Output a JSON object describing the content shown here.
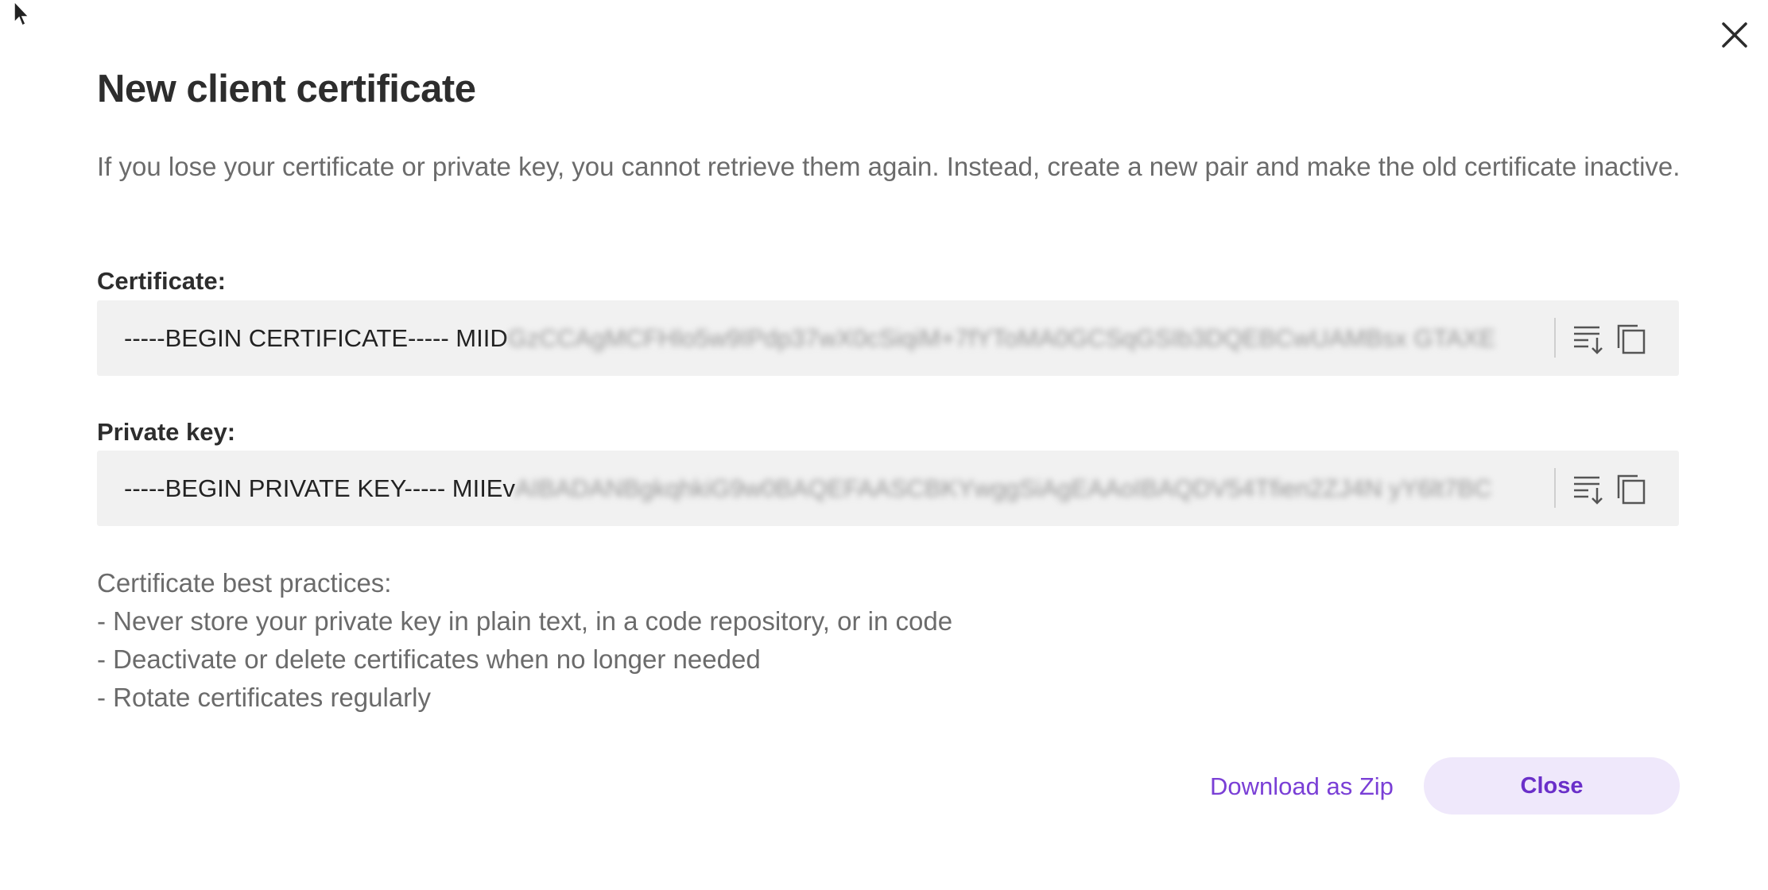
{
  "dialog": {
    "title": "New client certificate",
    "intro": "If you lose your certificate or private key, you cannot retrieve them again. Instead, create a new pair and make the old certificate inactive."
  },
  "certificate": {
    "label": "Certificate:",
    "value_visible": "-----BEGIN CERTIFICATE----- MIID",
    "value_blurred": "GzCCAgMCFHlo5w9IPdp37wX0cSiqiM+7fYToMA0GCSqGSIb3DQEBCwUAMBsx GTAXE"
  },
  "private_key": {
    "label": "Private key:",
    "value_visible": "-----BEGIN PRIVATE KEY----- MIIEv",
    "value_blurred": "AIBADANBgkqhkiG9w0BAQEFAASCBKYwggSiAgEAAoIBAQDV54Tfien2ZJ4N yY6lt7BC"
  },
  "best_practices": {
    "heading": "Certificate best practices:",
    "items": [
      "- Never store your private key in plain text, in a code repository, or in code",
      "- Deactivate or delete certificates when no longer needed",
      "- Rotate certificates regularly"
    ]
  },
  "actions": {
    "download_label": "Download as Zip",
    "close_label": "Close"
  },
  "icons": {
    "close": "close-icon",
    "download": "download-icon",
    "copy": "copy-icon",
    "cursor": "mouse-pointer-icon"
  },
  "colors": {
    "accent": "#7a3fd6",
    "accent_bg": "#efe8fb",
    "field_bg": "#f1f1f1",
    "muted_text": "#6b6b6b"
  }
}
